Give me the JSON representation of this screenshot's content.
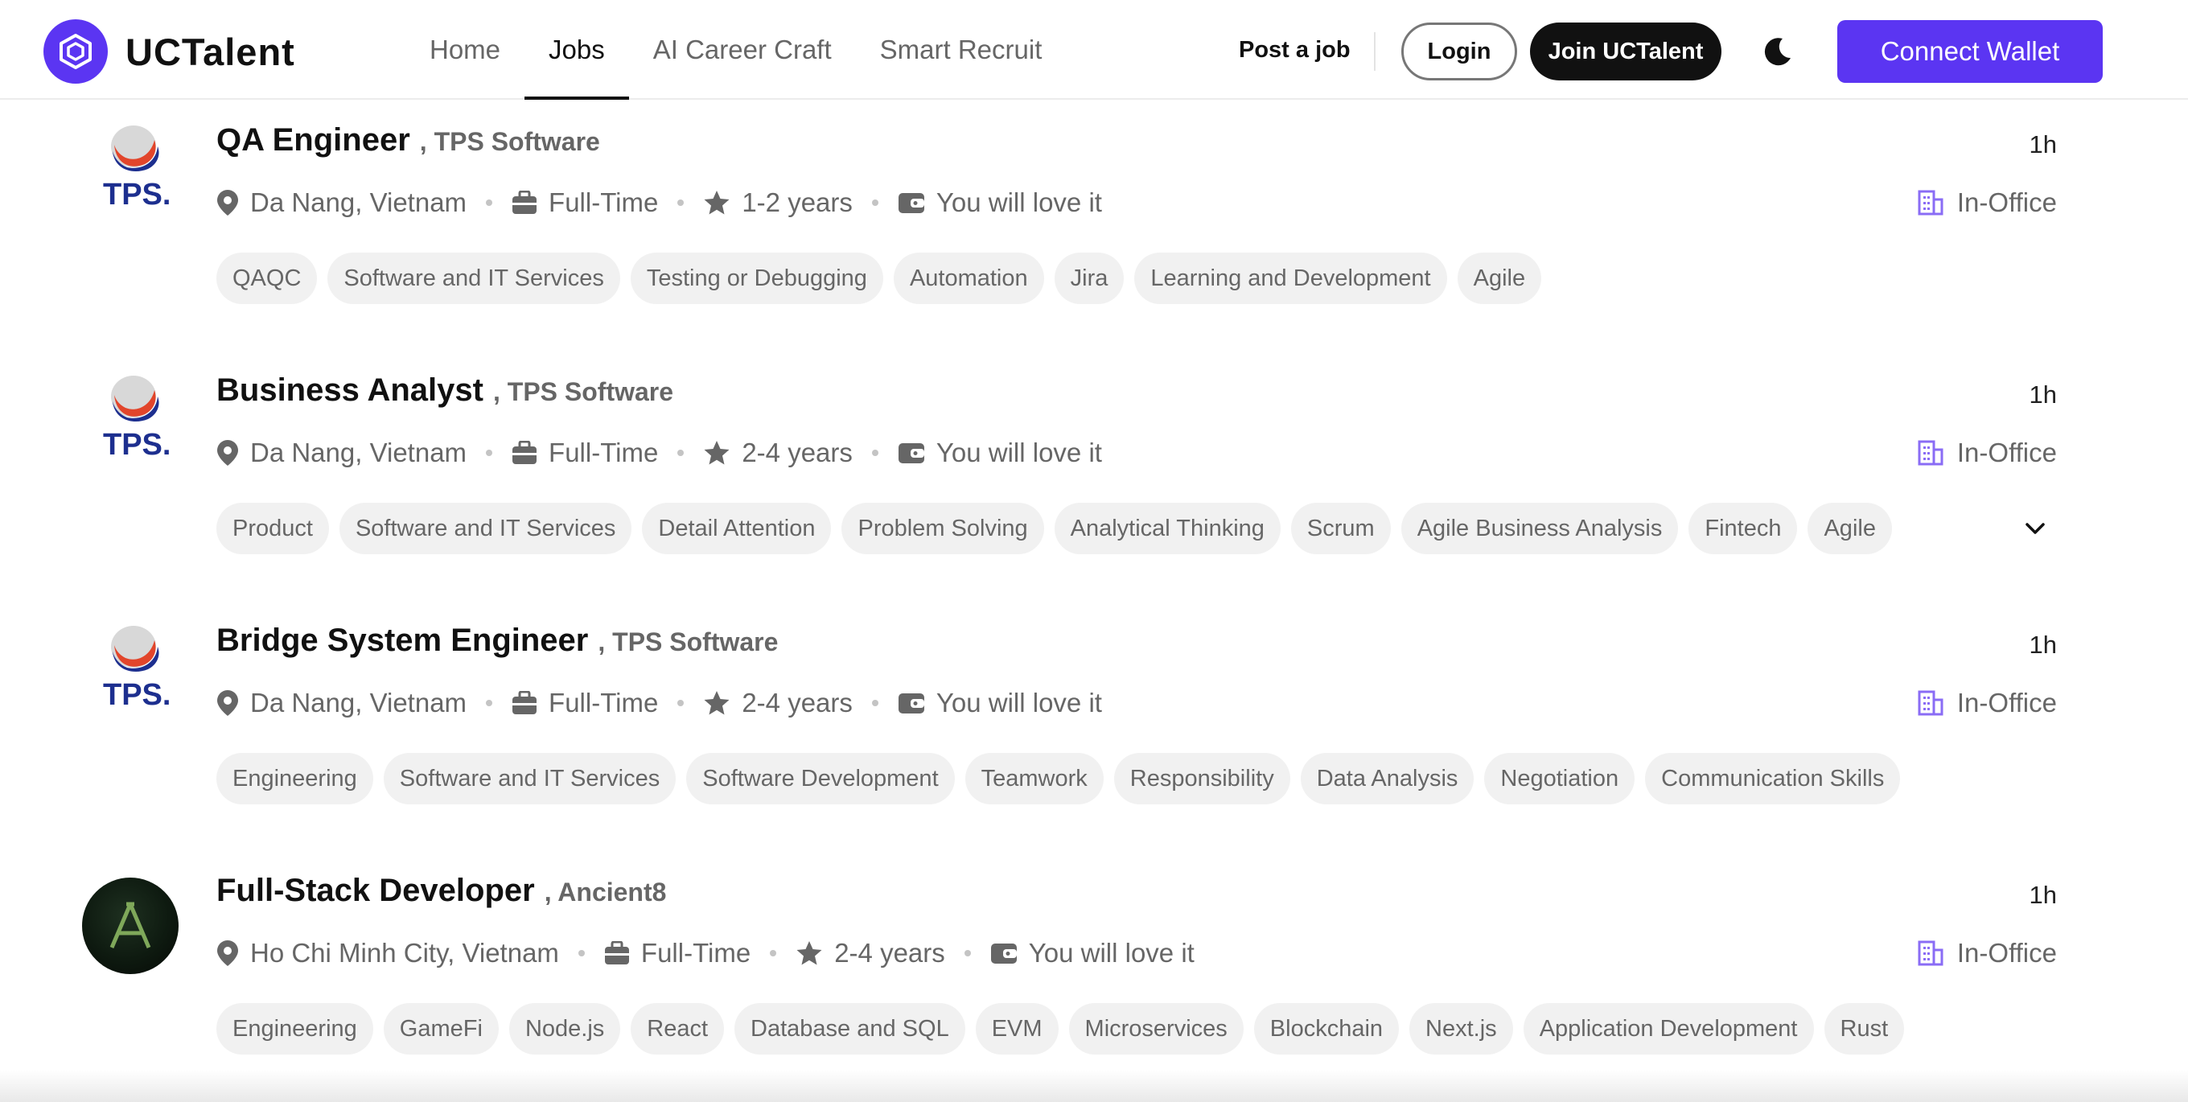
{
  "header": {
    "brand": "UCTalent",
    "nav": [
      "Home",
      "Jobs",
      "AI Career Craft",
      "Smart Recruit"
    ],
    "active_nav": "Jobs",
    "post_job": "Post a job",
    "login": "Login",
    "join": "Join UCTalent",
    "connect_wallet": "Connect Wallet"
  },
  "colors": {
    "accent": "#5b35f2",
    "dark": "#111111",
    "muted": "#666666",
    "tag_bg": "#f1f1f1"
  },
  "icons": [
    "location-pin-icon",
    "briefcase-icon",
    "star-icon",
    "wallet-icon",
    "building-icon",
    "moon-icon",
    "chevron-down-icon"
  ],
  "jobs": [
    {
      "title": "QA Engineer",
      "company": ", TPS Software",
      "time": "1h",
      "location": "Da Nang, Vietnam",
      "type": "Full-Time",
      "experience": "1-2 years",
      "salary": "You will love it",
      "work_mode": "In-Office",
      "tags": [
        "QAQC",
        "Software and IT Services",
        "Testing or Debugging",
        "Automation",
        "Jira",
        "Learning and Development",
        "Agile"
      ]
    },
    {
      "title": "Business Analyst",
      "company": ", TPS Software",
      "time": "1h",
      "location": "Da Nang, Vietnam",
      "type": "Full-Time",
      "experience": "2-4 years",
      "salary": "You will love it",
      "work_mode": "In-Office",
      "tags": [
        "Product",
        "Software and IT Services",
        "Detail Attention",
        "Problem Solving",
        "Analytical Thinking",
        "Scrum",
        "Agile Business Analysis",
        "Fintech",
        "Agile"
      ]
    },
    {
      "title": "Bridge System Engineer",
      "company": ", TPS Software",
      "time": "1h",
      "location": "Da Nang, Vietnam",
      "type": "Full-Time",
      "experience": "2-4 years",
      "salary": "You will love it",
      "work_mode": "In-Office",
      "tags": [
        "Engineering",
        "Software and IT Services",
        "Software Development",
        "Teamwork",
        "Responsibility",
        "Data Analysis",
        "Negotiation",
        "Communication Skills"
      ]
    },
    {
      "title": "Full-Stack Developer",
      "company": ", Ancient8",
      "time": "1h",
      "location": "Ho Chi Minh City, Vietnam",
      "type": "Full-Time",
      "experience": "2-4 years",
      "salary": "You will love it",
      "work_mode": "In-Office",
      "tags": [
        "Engineering",
        "GameFi",
        "Node.js",
        "React",
        "Database and SQL",
        "EVM",
        "Microservices",
        "Blockchain",
        "Next.js",
        "Application Development",
        "Rust"
      ]
    }
  ]
}
